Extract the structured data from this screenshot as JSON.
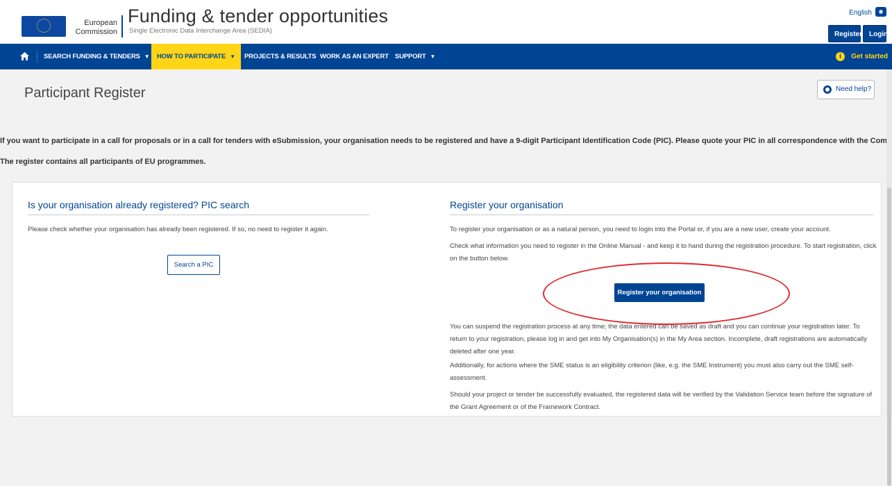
{
  "header": {
    "logo_line1": "European",
    "logo_line2": "Commission",
    "title": "Funding & tender opportunities",
    "subtitle": "Single Electronic Data Interchange Area (SEDIA)",
    "language": "English",
    "register_label": "Register",
    "login_label": "Login"
  },
  "nav": {
    "items": [
      {
        "label": "SEARCH FUNDING & TENDERS",
        "has_dropdown": true
      },
      {
        "label": "HOW TO PARTICIPATE",
        "has_dropdown": true,
        "active": true
      },
      {
        "label": "PROJECTS & RESULTS",
        "has_dropdown": false
      },
      {
        "label": "WORK AS AN EXPERT",
        "has_dropdown": false
      },
      {
        "label": "SUPPORT",
        "has_dropdown": true
      }
    ],
    "get_started": "Get started"
  },
  "page": {
    "title": "Participant Register",
    "help_label": "Need help?",
    "intro_1": "If you want to participate in a call for proposals or in a call for tenders with eSubmission, your organisation needs to be registered and have a 9-digit Participant Identification Code (PIC). Please quote your PIC in all correspondence with the Commission.",
    "intro_2": "The register contains all participants of EU programmes."
  },
  "left_panel": {
    "title": "Is your organisation already registered? PIC search",
    "text": "Please check whether your organisation has already been registered. If so, no need to register it again.",
    "button": "Search a PIC"
  },
  "right_panel": {
    "title": "Register your organisation",
    "p1": "To register your organisation or as a natural person, you need to login into the Portal or, if you are a new user, create your account.",
    "p2": "Check what information you need to register in the Online Manual - and keep it to hand during the registration procedure. To start registration, click on the button below.",
    "button": "Register your organisation",
    "p3": "You can suspend the registration process at any time; the data entered can be saved as draft and you can continue your registration later. To return to your registration, please log in and get into My Organisation(s) in the My Area section. Incomplete, draft registrations are automatically deleted after one year.",
    "p4": "Additionally, for actions where the SME status is an eligibility criterion (like, e.g. the SME Instrument) you must also carry out the SME self-assessment.",
    "p5": "Should your project or tender be successfully evaluated, the registered data will be verified by the Validation Service team before the signature of the Grant Agreement or of the Framework Contract."
  },
  "colors": {
    "brand_blue": "#004494",
    "active_yellow": "#ffd617",
    "highlight_red": "#e0292f"
  }
}
